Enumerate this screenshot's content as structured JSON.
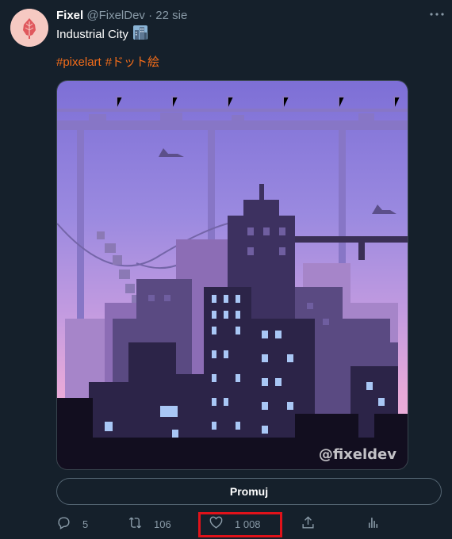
{
  "tweet": {
    "author_name": "Fixel",
    "handle": "@FixelDev",
    "separator": "·",
    "date": "22 sie",
    "text": "Industrial City",
    "hashtags": [
      "#pixelart",
      "#ドット絵"
    ],
    "image": {
      "watermark": "@fixeldev"
    }
  },
  "promote_label": "Promuj",
  "actions": {
    "reply_count": "5",
    "retweet_count": "106",
    "like_count": "1 008"
  },
  "colors": {
    "background": "#15202b",
    "hashtag": "#f26c1a",
    "muted": "#8899a6",
    "highlight": "#e0121a"
  },
  "icons": [
    "more-icon",
    "building-emoji-icon",
    "reply-icon",
    "retweet-icon",
    "like-icon",
    "share-icon",
    "analytics-icon"
  ]
}
